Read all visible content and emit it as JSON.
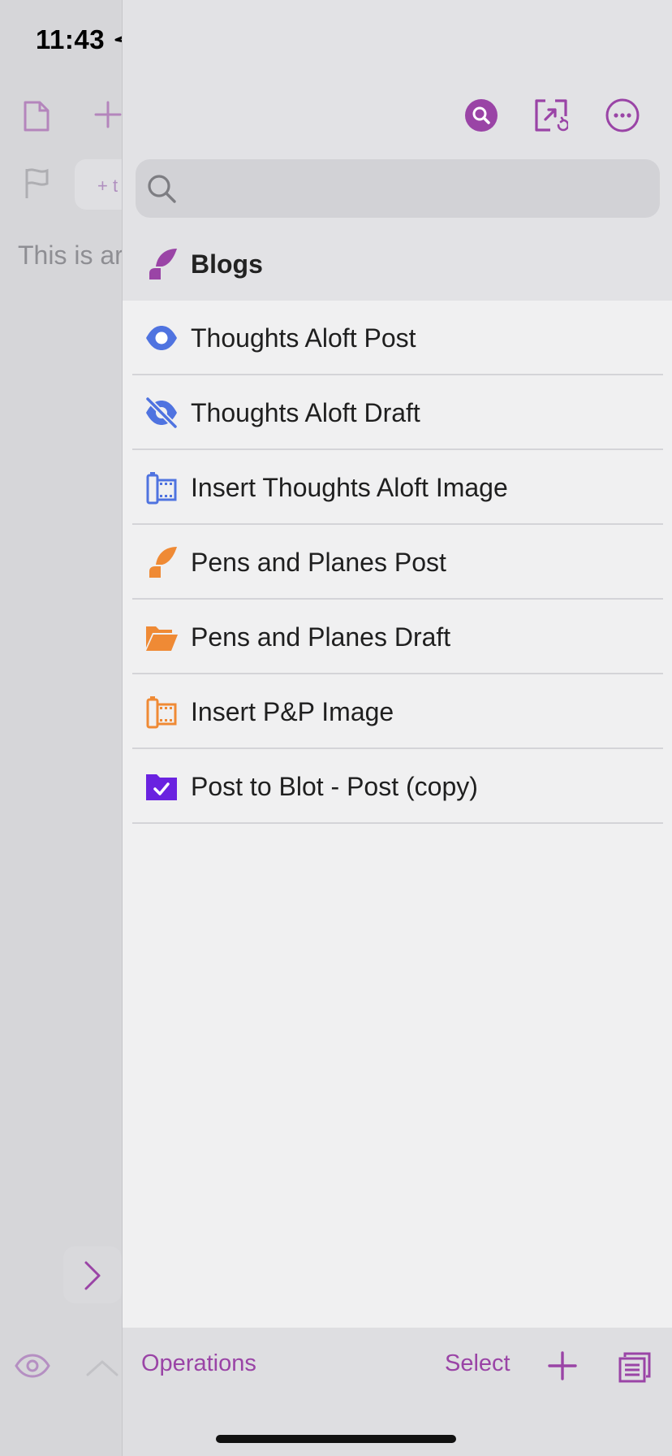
{
  "status_bar": {
    "time": "11:43"
  },
  "background_editor": {
    "body_text": "This is ar",
    "tag_label": "+ t"
  },
  "panel": {
    "search": {
      "placeholder": "",
      "value": ""
    },
    "group": {
      "label": "Blogs",
      "icon": "quill-icon",
      "color": "#9a44a6"
    },
    "items": [
      {
        "label": "Thoughts Aloft Post",
        "icon": "eye-icon",
        "color": "#4f73e0"
      },
      {
        "label": "Thoughts Aloft Draft",
        "icon": "eye-slash-icon",
        "color": "#4f73e0"
      },
      {
        "label": "Insert Thoughts Aloft Image",
        "icon": "film-icon",
        "color": "#4f73e0"
      },
      {
        "label": "Pens and Planes Post",
        "icon": "quill-icon",
        "color": "#ef8a35"
      },
      {
        "label": "Pens and Planes Draft",
        "icon": "folder-open-icon",
        "color": "#ef8a35"
      },
      {
        "label": "Insert P&P Image",
        "icon": "film-icon",
        "color": "#ef8a35"
      },
      {
        "label": "Post to Blot - Post (copy)",
        "icon": "folder-check-icon",
        "color": "#6a22e0"
      }
    ]
  },
  "toolbar": {
    "operations_label": "Operations",
    "select_label": "Select"
  },
  "colors": {
    "accent": "#9a44a6"
  }
}
